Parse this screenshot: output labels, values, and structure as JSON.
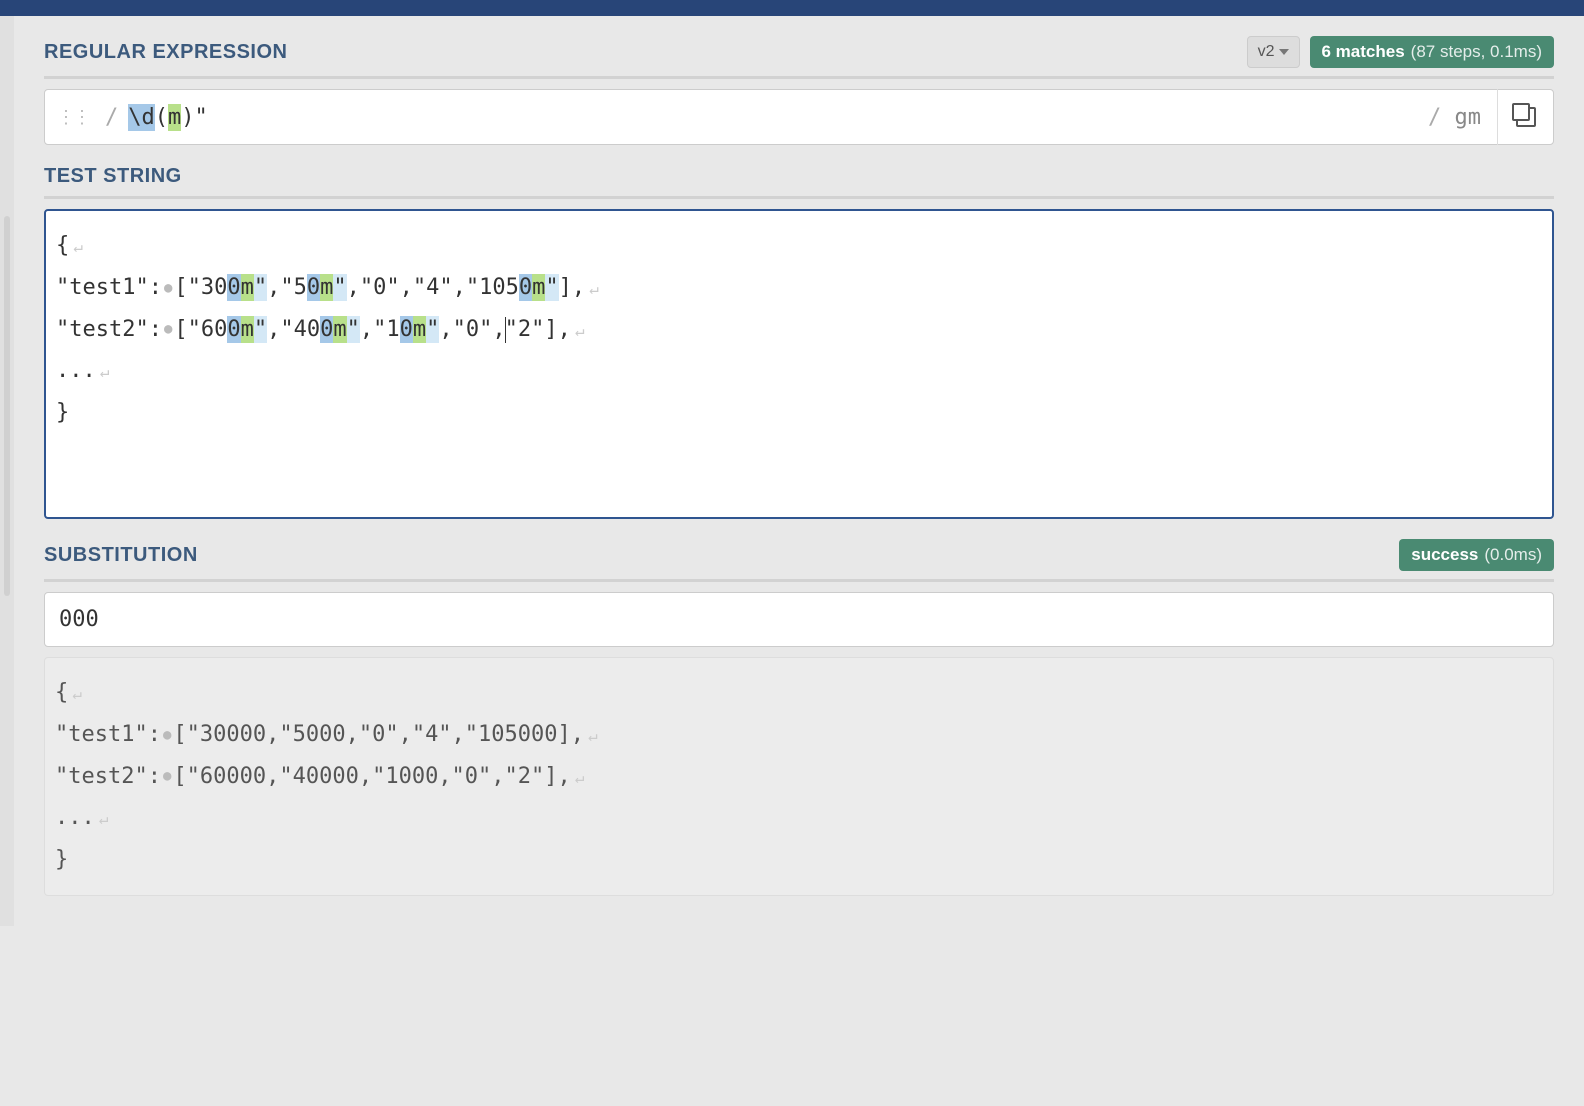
{
  "sections": {
    "regex_title": "REGULAR EXPRESSION",
    "test_title": "TEST STRING",
    "sub_title": "SUBSTITUTION"
  },
  "regex": {
    "version": "v2",
    "pattern_leading": "\\d",
    "pattern_group_open": "(",
    "pattern_group_inner": "m",
    "pattern_group_close": ")",
    "pattern_trailing": "\"",
    "flags": "gm",
    "slash": "/"
  },
  "match_info": {
    "count_label": "6 matches",
    "detail": "(87 steps, 0.1ms)"
  },
  "test_string": {
    "line1_open": "{",
    "line2_pre": "\"test1\":",
    "line2_a": "[\"30",
    "line2_m1d": "0",
    "line2_m1m": "m",
    "line2_m1q": "\"",
    "line2_b": ",\"5",
    "line2_m2d": "0",
    "line2_m2m": "m",
    "line2_m2q": "\"",
    "line2_c": ",\"0\",\"4\",\"105",
    "line2_m3d": "0",
    "line2_m3m": "m",
    "line2_m3q": "\"",
    "line2_d": "],",
    "line3_pre": "\"test2\":",
    "line3_a": "[\"60",
    "line3_m1d": "0",
    "line3_m1m": "m",
    "line3_m1q": "\"",
    "line3_b": ",\"40",
    "line3_m2d": "0",
    "line3_m2m": "m",
    "line3_m2q": "\"",
    "line3_c": ",\"1",
    "line3_m3d": "0",
    "line3_m3m": "m",
    "line3_m3q": "\"",
    "line3_d": ",\"0\",",
    "line3_e": "\"2\"],",
    "line4": "...",
    "line5": "}"
  },
  "substitution": {
    "input": "000",
    "status_label": "success",
    "status_time": "(0.0ms)",
    "out_line1": "{",
    "out_line2_pre": "\"test1\":",
    "out_line2_rest": "[\"30000,\"5000,\"0\",\"4\",\"105000],",
    "out_line3_pre": "\"test2\":",
    "out_line3_rest": "[\"60000,\"40000,\"1000,\"0\",\"2\"],",
    "out_line4": "...",
    "out_line5": "}"
  }
}
